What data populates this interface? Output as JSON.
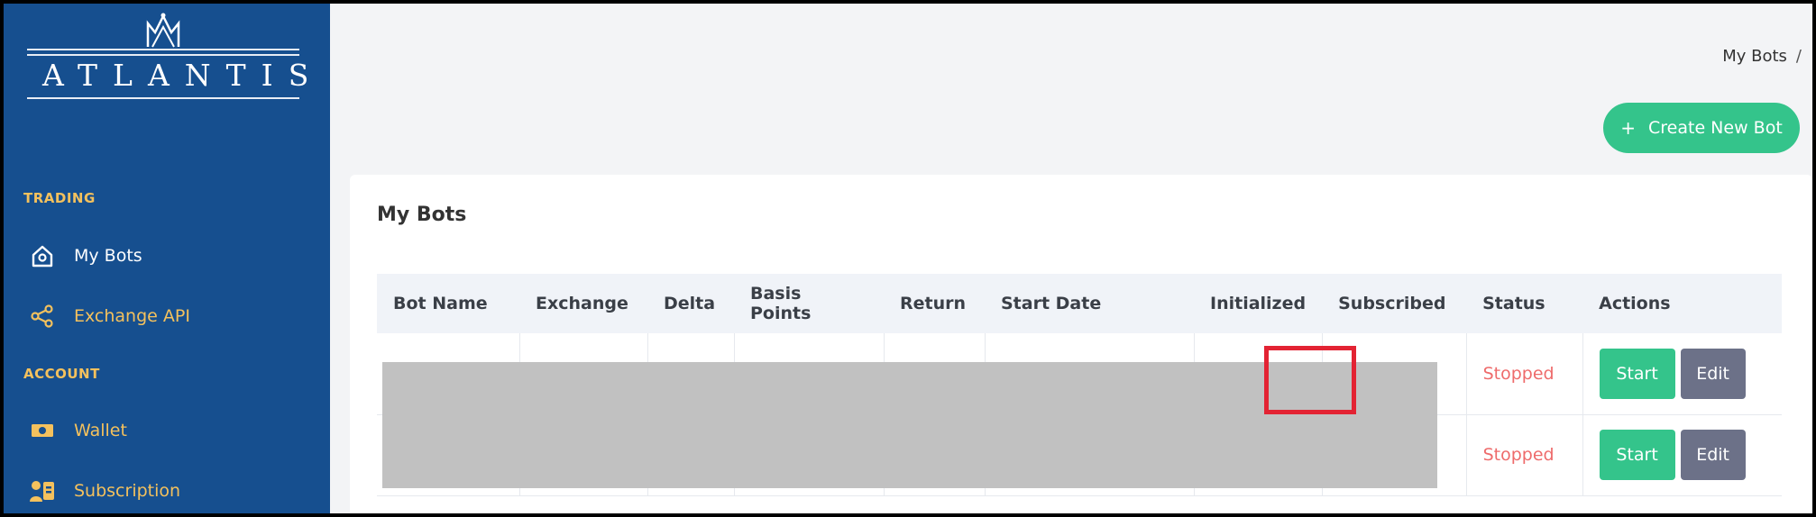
{
  "brand": {
    "name": "ATLANTIS"
  },
  "sidebar": {
    "sections": [
      {
        "title": "TRADING",
        "items": [
          {
            "label": "My Bots",
            "icon": "home-icon",
            "active": true
          },
          {
            "label": "Exchange API",
            "icon": "share-icon",
            "active": false
          }
        ]
      },
      {
        "title": "ACCOUNT",
        "items": [
          {
            "label": "Wallet",
            "icon": "wallet-icon",
            "active": false
          },
          {
            "label": "Subscription",
            "icon": "subscription-icon",
            "active": false
          }
        ]
      }
    ]
  },
  "header": {
    "breadcrumb": "My Bots",
    "breadcrumb_separator": "/",
    "create_button": {
      "label": "Create New Bot",
      "icon": "plus-icon"
    }
  },
  "card": {
    "title": "My Bots"
  },
  "table": {
    "columns": [
      "Bot Name",
      "Exchange",
      "Delta",
      "Basis Points",
      "Return",
      "Start Date",
      "Initialized",
      "Subscribed",
      "Status",
      "Actions"
    ],
    "rows": [
      {
        "status": "Stopped",
        "start_label": "Start",
        "edit_label": "Edit"
      },
      {
        "status": "Stopped",
        "start_label": "Start",
        "edit_label": "Edit"
      }
    ]
  },
  "colors": {
    "sidebar_bg": "#164f8f",
    "sidebar_section": "#f4c15d",
    "primary_green": "#34c48b",
    "edit_gray": "#6c7188",
    "status_red": "#ee6b6b",
    "highlight_red": "#e32333"
  }
}
